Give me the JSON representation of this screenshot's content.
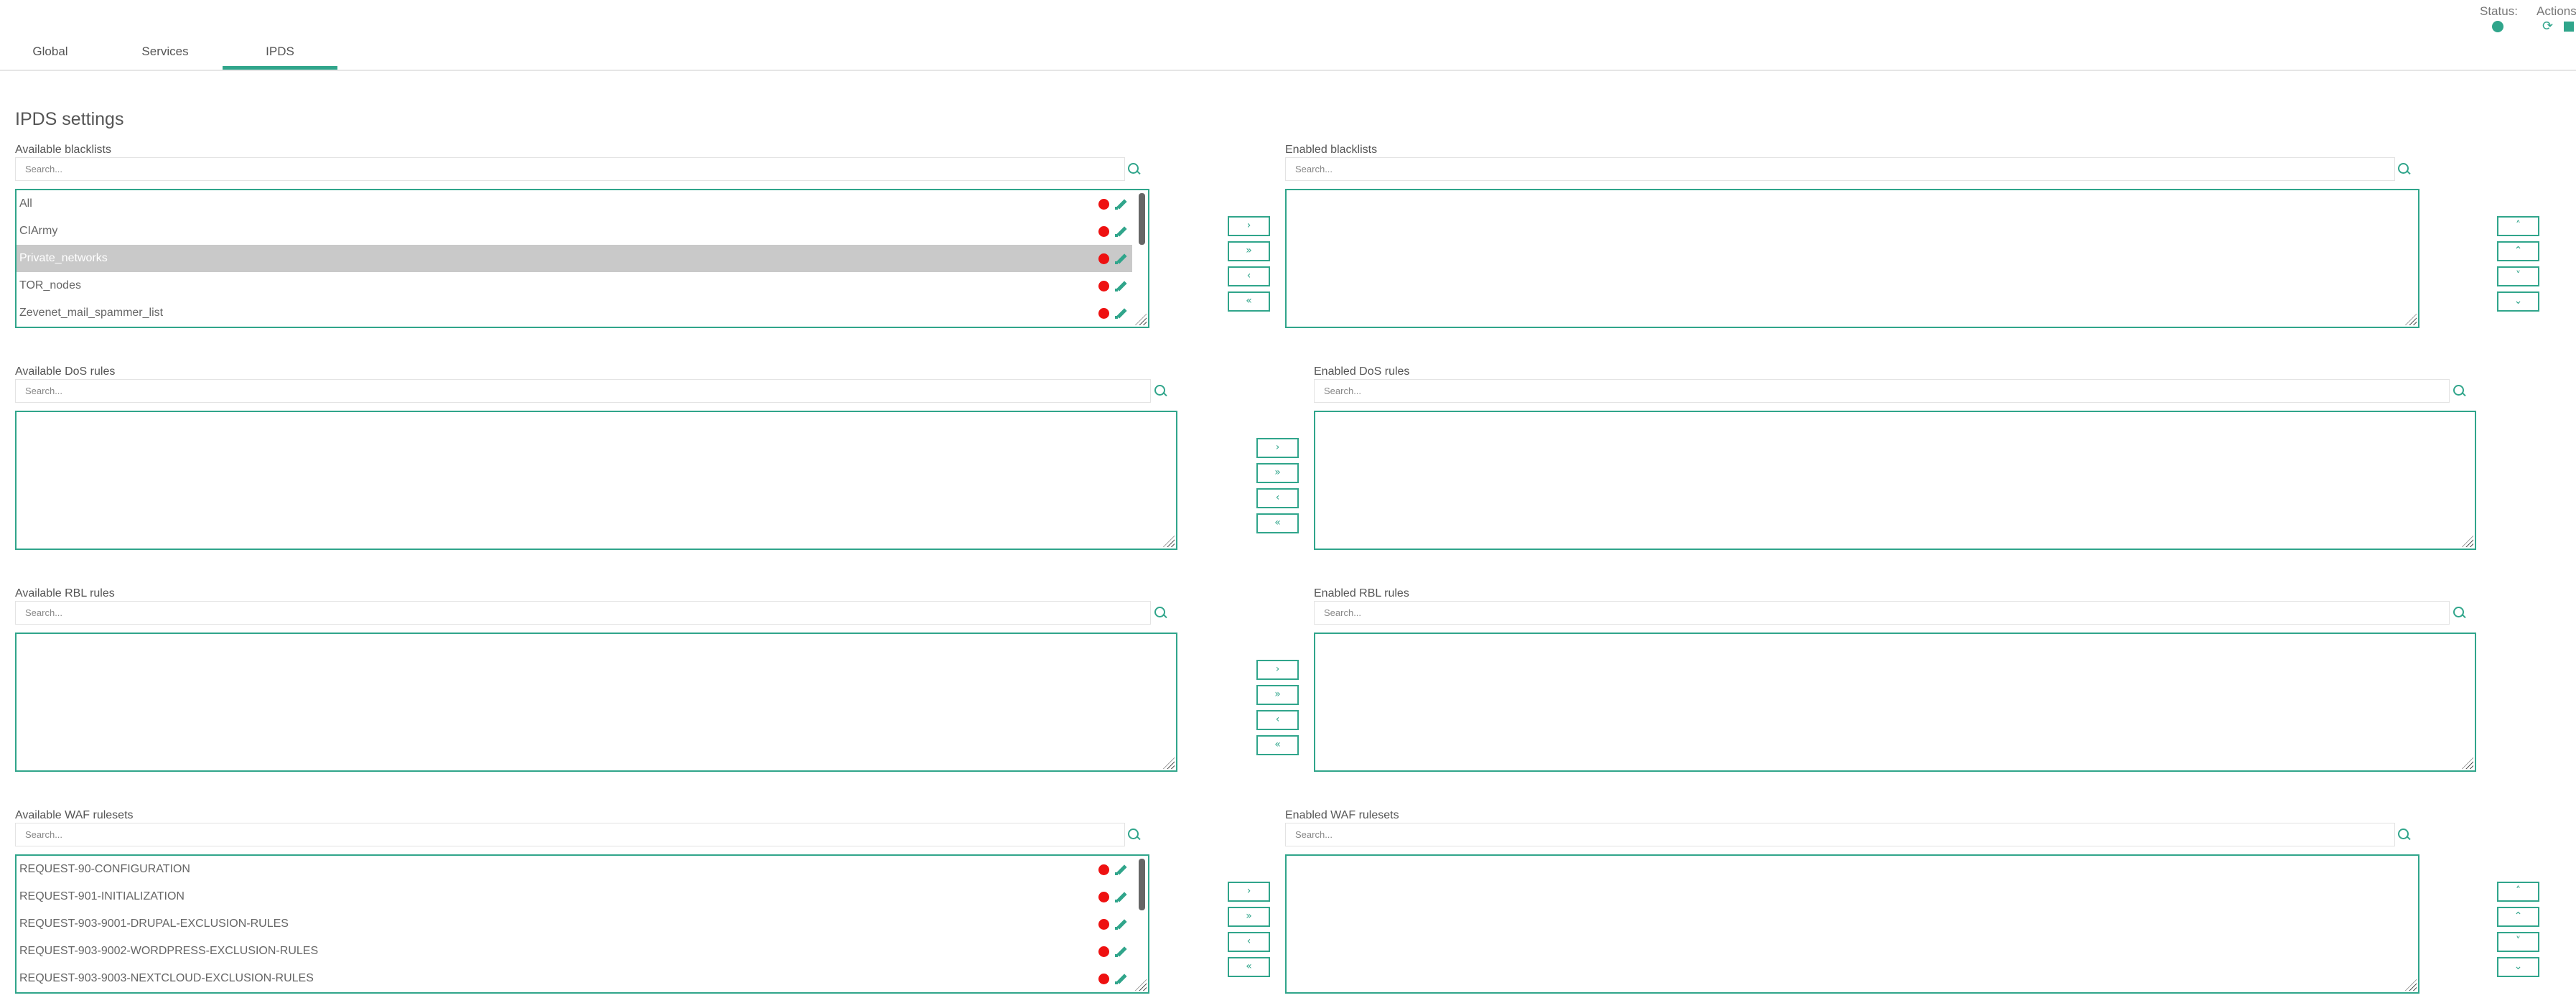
{
  "tabs": [
    {
      "label": "Global"
    },
    {
      "label": "Services"
    },
    {
      "label": "IPDS"
    }
  ],
  "status": {
    "label": "Status:",
    "indicator": "online",
    "color": "#30a58b"
  },
  "actions": {
    "label": "Actions:",
    "restart_icon": "restart-icon",
    "stop_icon": "stop-icon"
  },
  "page_title": "IPDS settings",
  "search_placeholder": "Search...",
  "transfer_buttons": [
    "›",
    "»",
    "‹",
    "«"
  ],
  "order_buttons": [
    "˄",
    "⌃",
    "˅",
    "⌄"
  ],
  "colors": {
    "accent": "#30a58b",
    "status_red": "#ee1111",
    "selected_row": "#c9c9c9"
  },
  "sections": {
    "blacklists": {
      "available_label": "Available blacklists",
      "enabled_label": "Enabled blacklists",
      "available_items": [
        "All",
        "CIArmy",
        "Private_networks",
        "TOR_nodes",
        "Zevenet_mail_spammer_list"
      ],
      "selected_item": "Private_networks",
      "enabled_items": []
    },
    "dos": {
      "available_label": "Available DoS rules",
      "enabled_label": "Enabled DoS rules",
      "available_items": [],
      "enabled_items": []
    },
    "rbl": {
      "available_label": "Available RBL rules",
      "enabled_label": "Enabled RBL rules",
      "available_items": [],
      "enabled_items": []
    },
    "waf": {
      "available_label": "Available WAF rulesets",
      "enabled_label": "Enabled WAF rulesets",
      "available_items": [
        "REQUEST-90-CONFIGURATION",
        "REQUEST-901-INITIALIZATION",
        "REQUEST-903-9001-DRUPAL-EXCLUSION-RULES",
        "REQUEST-903-9002-WORDPRESS-EXCLUSION-RULES",
        "REQUEST-903-9003-NEXTCLOUD-EXCLUSION-RULES"
      ],
      "enabled_items": []
    }
  }
}
